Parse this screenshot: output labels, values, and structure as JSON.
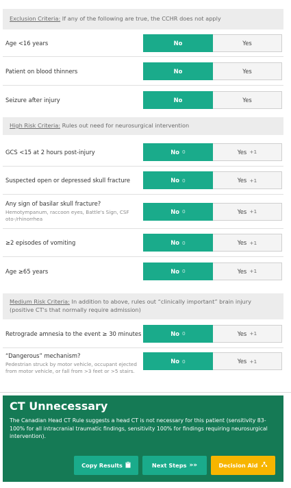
{
  "sections": {
    "exclusion": {
      "title": "Exclusion Criteria:",
      "desc": " If any of the following are true, the CCHR does not apply",
      "rows": [
        {
          "label": "Age <16 years",
          "no": "No",
          "yes": "Yes"
        },
        {
          "label": "Patient on blood thinners",
          "no": "No",
          "yes": "Yes"
        },
        {
          "label": "Seizure after injury",
          "no": "No",
          "yes": "Yes"
        }
      ]
    },
    "high": {
      "title": "High Risk Criteria:",
      "desc": " Rules out need for neurosurgical intervention",
      "rows": [
        {
          "label": "GCS <15 at 2 hours post-injury",
          "no": "No",
          "no_pts": "0",
          "yes": "Yes",
          "yes_pts": "+1"
        },
        {
          "label": "Suspected open or depressed skull fracture",
          "no": "No",
          "no_pts": "0",
          "yes": "Yes",
          "yes_pts": "+1"
        },
        {
          "label": "Any sign of basilar skull fracture?",
          "sub": "Hemotympanum, raccoon eyes, Battle's Sign, CSF oto-/rhinorrhea",
          "no": "No",
          "no_pts": "0",
          "yes": "Yes",
          "yes_pts": "+1"
        },
        {
          "label": "≥2 episodes of vomiting",
          "no": "No",
          "no_pts": "0",
          "yes": "Yes",
          "yes_pts": "+1"
        },
        {
          "label": "Age ≥65 years",
          "no": "No",
          "no_pts": "0",
          "yes": "Yes",
          "yes_pts": "+1"
        }
      ]
    },
    "medium": {
      "title": "Medium Risk Criteria:",
      "desc": " In addition to above, rules out “clinically important” brain injury (positive CT's that normally require admission)",
      "rows": [
        {
          "label": "Retrograde amnesia to the event ≥ 30 minutes",
          "no": "No",
          "no_pts": "0",
          "yes": "Yes",
          "yes_pts": "+1"
        },
        {
          "label": "“Dangerous” mechanism?",
          "sub": "Pedestrian struck by motor vehicle, occupant ejected from motor vehicle, or fall from >3 feet or >5 stairs.",
          "no": "No",
          "no_pts": "0",
          "yes": "Yes",
          "yes_pts": "+1"
        }
      ]
    }
  },
  "result": {
    "title": "CT Unnecessary",
    "text": "The Canadian Head CT Rule suggests a head CT is not necessary for this patient (sensitivity 83-100% for all intracranial traumatic findings, sensitivity 100% for findings requiring neurosurgical intervention).",
    "buttons": {
      "copy": "Copy Results",
      "next": "Next Steps",
      "aid": "Decision Aid"
    }
  },
  "colors": {
    "selected": "#1aab8b",
    "result_bg": "#157a55",
    "decision_aid": "#f7b500"
  }
}
